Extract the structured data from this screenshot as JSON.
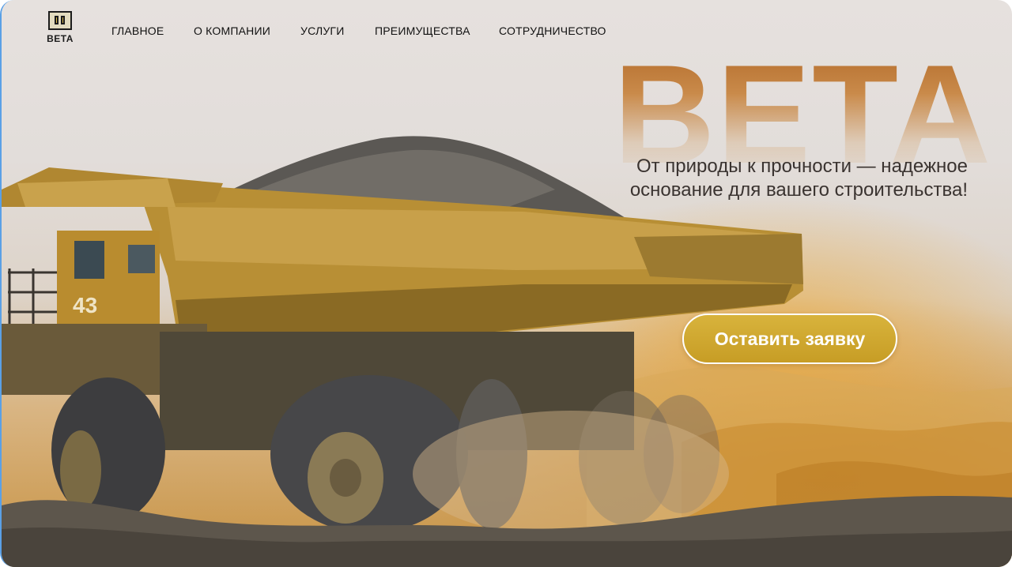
{
  "logo": {
    "icon": "building-logo-icon",
    "text": "BETA"
  },
  "nav": {
    "items": [
      {
        "label": "ГЛАВНОЕ"
      },
      {
        "label": "О КОМПАНИИ"
      },
      {
        "label": "УСЛУГИ"
      },
      {
        "label": "ПРЕИМУЩЕСТВА"
      },
      {
        "label": "СОТРУДНИЧЕСТВО"
      }
    ]
  },
  "hero": {
    "brand": "BETA",
    "tagline_line1": "От природы к прочности — надежное",
    "tagline_line2": "основание для вашего строительства!",
    "cta_label": "Оставить заявку",
    "truck_number": "43"
  },
  "colors": {
    "accent": "#c9a02a",
    "brand_gradient_top": "#b36b2a",
    "text_dark": "#111111"
  }
}
